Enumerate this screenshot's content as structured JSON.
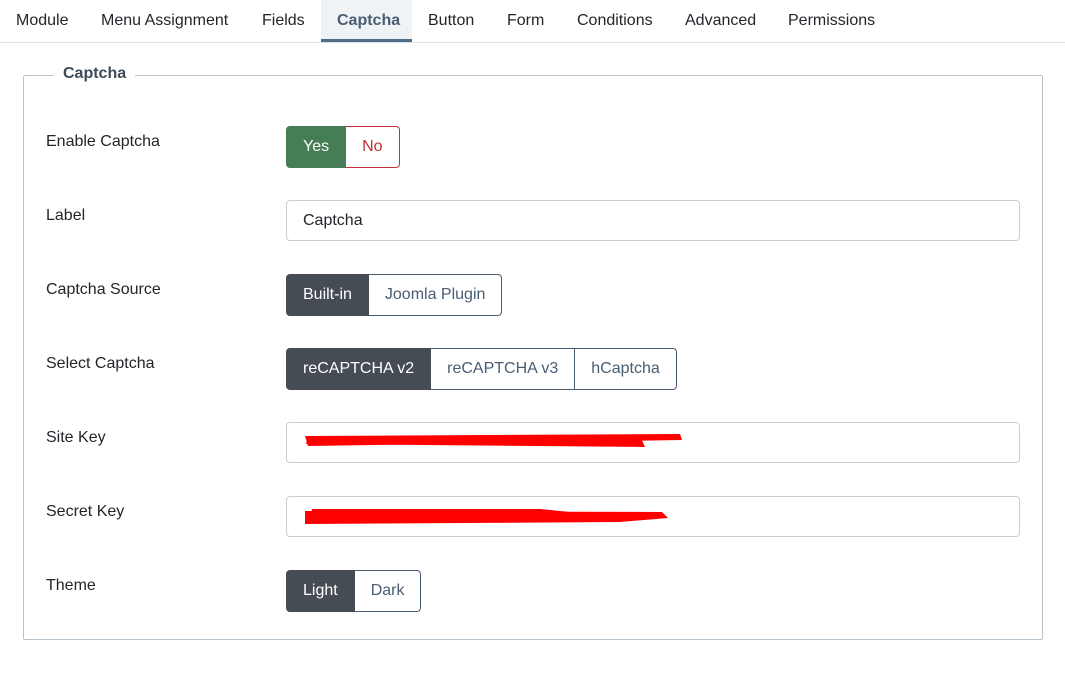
{
  "tabs": [
    {
      "label": "Module"
    },
    {
      "label": "Menu Assignment"
    },
    {
      "label": "Fields"
    },
    {
      "label": "Captcha"
    },
    {
      "label": "Button"
    },
    {
      "label": "Form"
    },
    {
      "label": "Conditions"
    },
    {
      "label": "Advanced"
    },
    {
      "label": "Permissions"
    }
  ],
  "active_tab": "Captcha",
  "panel": {
    "legend": "Captcha",
    "enable_captcha": {
      "label": "Enable Captcha",
      "options": [
        "Yes",
        "No"
      ],
      "selected": "Yes"
    },
    "label_field": {
      "label": "Label",
      "value": "Captcha"
    },
    "captcha_source": {
      "label": "Captcha Source",
      "options": [
        "Built-in",
        "Joomla Plugin"
      ],
      "selected": "Built-in"
    },
    "select_captcha": {
      "label": "Select Captcha",
      "options": [
        "reCAPTCHA v2",
        "reCAPTCHA v3",
        "hCaptcha"
      ],
      "selected": "reCAPTCHA v2"
    },
    "site_key": {
      "label": "Site Key"
    },
    "secret_key": {
      "label": "Secret Key"
    },
    "theme": {
      "label": "Theme",
      "options": [
        "Light",
        "Dark"
      ],
      "selected": "Light"
    }
  },
  "colors": {
    "active_tab_text": "#495d73",
    "selected_dark": "#454c54",
    "selected_green": "#457d54",
    "no_red": "#c5303a",
    "redaction": "#ff0000"
  }
}
